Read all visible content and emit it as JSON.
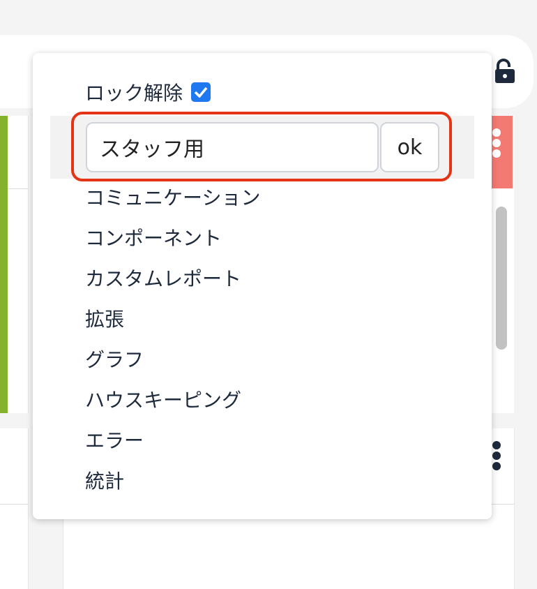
{
  "header": {
    "lock_icon": "unlock-icon"
  },
  "dropdown": {
    "unlock_label": "ロック解除",
    "unlock_checked": true,
    "text_input_value": "スタッフ用",
    "ok_label": "ok",
    "items": [
      "コミュニケーション",
      "コンポーネント",
      "カスタムレポート",
      "拡張",
      "グラフ",
      "ハウスキーピング",
      "エラー",
      "統計"
    ]
  },
  "colors": {
    "green_accent": "#85b22c",
    "red_header": "#f37a72",
    "highlight_outline": "#e53316",
    "checkbox_blue": "#1f78f0",
    "text": "#1e2a3b"
  }
}
